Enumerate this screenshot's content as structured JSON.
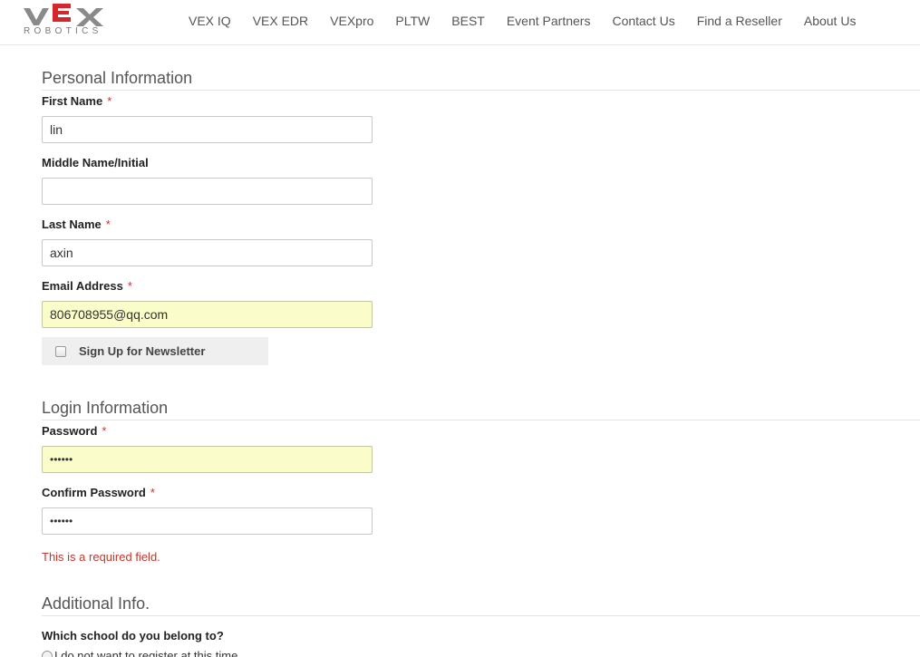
{
  "header": {
    "logo_text": "VEX",
    "logo_sub": "ROBOTICS",
    "nav": [
      {
        "label": "VEX IQ"
      },
      {
        "label": "VEX EDR"
      },
      {
        "label": "VEXpro"
      },
      {
        "label": "PLTW"
      },
      {
        "label": "BEST"
      },
      {
        "label": "Event Partners"
      },
      {
        "label": "Contact Us"
      },
      {
        "label": "Find a Reseller"
      },
      {
        "label": "About Us"
      }
    ]
  },
  "personal": {
    "title": "Personal Information",
    "first_name": {
      "label": "First Name",
      "required": "*",
      "value": "lin"
    },
    "middle_name": {
      "label": "Middle Name/Initial",
      "value": ""
    },
    "last_name": {
      "label": "Last Name",
      "required": "*",
      "value": "axin"
    },
    "email": {
      "label": "Email Address",
      "required": "*",
      "value": "806708955@qq.com"
    },
    "newsletter": {
      "label": "Sign Up for Newsletter",
      "checked": false
    }
  },
  "login": {
    "title": "Login Information",
    "password": {
      "label": "Password",
      "required": "*",
      "value": "••••••"
    },
    "confirm_password": {
      "label": "Confirm Password",
      "required": "*",
      "value": "••••••"
    },
    "error": "This is a required field."
  },
  "additional": {
    "title": "Additional Info.",
    "question": "Which school do you belong to?",
    "option_partial": "I do not want to register at this time"
  },
  "colors": {
    "logo_red": "#d6262c",
    "logo_gray": "#8a8a8a",
    "error": "#c0392b",
    "required": "#cc3333",
    "autofill": "#fafcc9"
  }
}
